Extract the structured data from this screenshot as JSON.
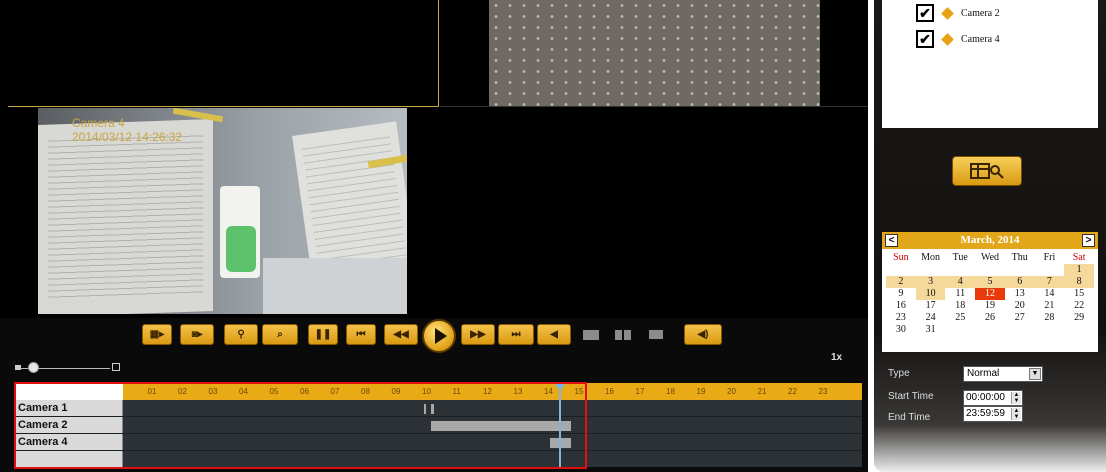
{
  "video": {
    "camera_label": "Camera 4",
    "timestamp": "2014/03/12 14:26:32"
  },
  "controls": {
    "speed": "1x",
    "buttons": {
      "record_icon": "film-open-icon",
      "snapshot_icon": "camera-open-icon",
      "zoom_icon": "magnifier-icon",
      "search_icon": "search-icon",
      "pause_icon": "pause-icon",
      "first_frame_icon": "skip-start-icon",
      "rewind_icon": "rewind-icon",
      "play_icon": "play-icon",
      "fast_forward_icon": "fast-forward-icon",
      "last_frame_icon": "skip-end-icon",
      "step_back_icon": "step-back-icon",
      "volume_icon": "speaker-icon"
    },
    "layouts": [
      "single-layout-icon",
      "quad-layout-icon",
      "fullscreen-icon"
    ]
  },
  "timeline": {
    "hours": [
      "01",
      "02",
      "03",
      "04",
      "05",
      "06",
      "07",
      "08",
      "09",
      "10",
      "11",
      "12",
      "13",
      "14",
      "15",
      "16",
      "17",
      "18",
      "19",
      "20",
      "21",
      "22",
      "23"
    ],
    "cursor_hour": 14.5,
    "rows": [
      {
        "label": "Camera 1",
        "segments": [
          [
            10.05,
            10.1
          ],
          [
            10.3,
            10.4
          ]
        ]
      },
      {
        "label": "Camera 2",
        "segments": [
          [
            10.3,
            14.9
          ]
        ]
      },
      {
        "label": "Camera 4",
        "segments": [
          [
            14.2,
            14.9
          ]
        ]
      },
      {
        "label": "",
        "segments": []
      }
    ]
  },
  "camera_list": {
    "items": [
      {
        "label": "Camera 2",
        "checked": true
      },
      {
        "label": "Camera 4",
        "checked": true
      }
    ]
  },
  "calendar": {
    "month_label": "March, 2014",
    "prev": "<",
    "next": ">",
    "weekdays": [
      "Sun",
      "Mon",
      "Tue",
      "Wed",
      "Thu",
      "Fri",
      "Sat"
    ],
    "weeks": [
      [
        "",
        "",
        "",
        "",
        "",
        "",
        "1"
      ],
      [
        "2",
        "3",
        "4",
        "5",
        "6",
        "7",
        "8"
      ],
      [
        "9",
        "10",
        "11",
        "12",
        "13",
        "14",
        "15"
      ],
      [
        "16",
        "17",
        "18",
        "19",
        "20",
        "21",
        "22"
      ],
      [
        "23",
        "24",
        "25",
        "26",
        "27",
        "28",
        "29"
      ],
      [
        "30",
        "31",
        "",
        "",
        "",
        "",
        ""
      ]
    ],
    "highlighted": [
      "1",
      "2",
      "3",
      "4",
      "5",
      "6",
      "7",
      "8",
      "10"
    ],
    "selected": "12"
  },
  "search": {
    "type_label": "Type",
    "type_value": "Normal",
    "start_label": "Start Time",
    "start_value": "00:00:00",
    "end_label": "End Time",
    "end_value": "23:59:59"
  }
}
